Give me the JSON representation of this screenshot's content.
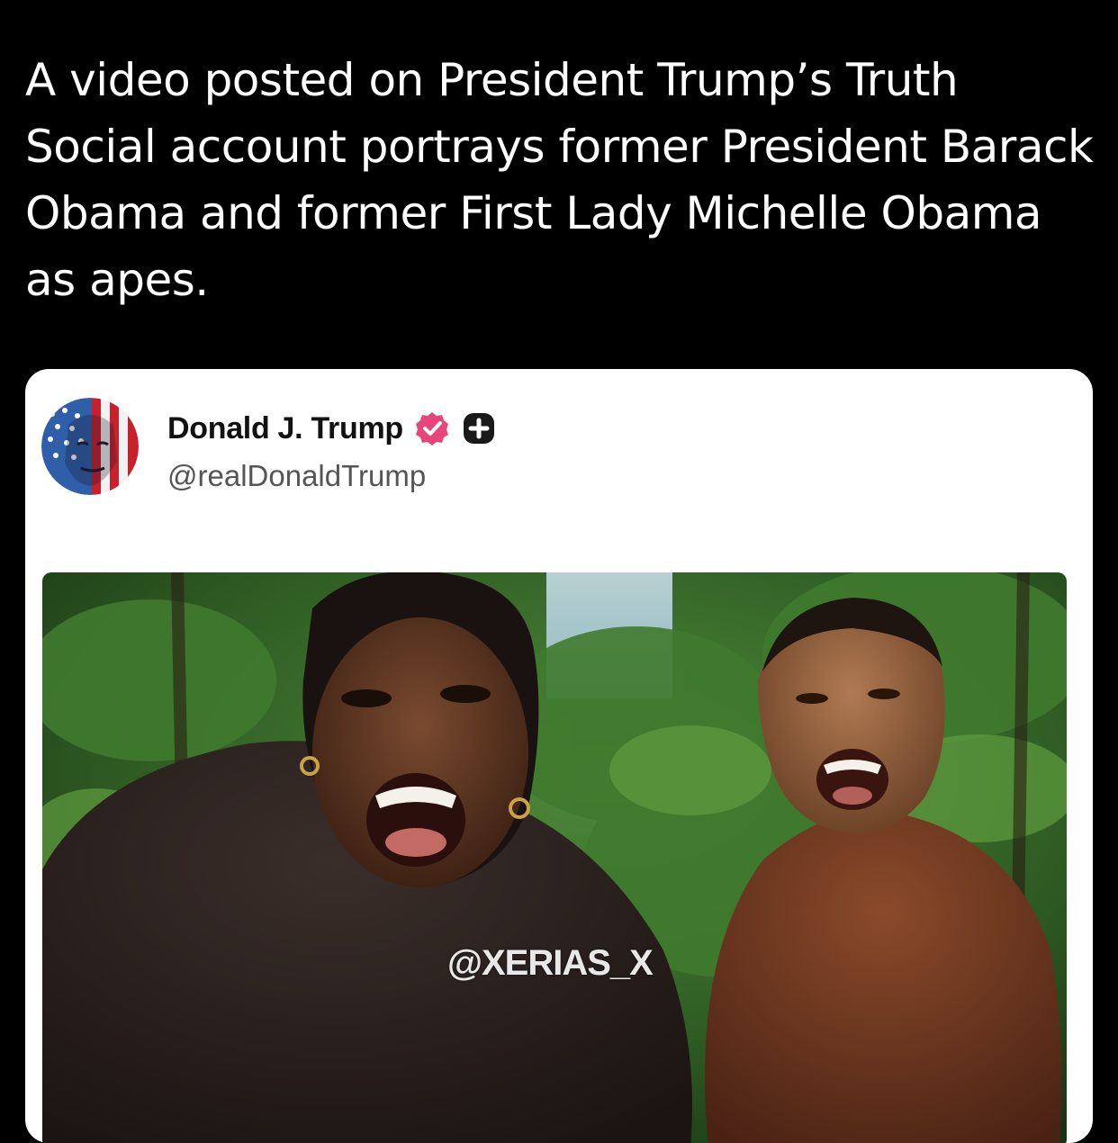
{
  "headline": "A video posted on President Trump’s Truth Social account portrays former President Barack Obama and former First Lady Michelle Obama as apes.",
  "post": {
    "display_name": "Donald J. Trump",
    "handle": "@realDonaldTrump",
    "icons": {
      "avatar": "flag-portrait-avatar",
      "verified": "verified-badge-icon",
      "plus": "plus-badge-icon"
    },
    "media": {
      "watermark": "@XERIAS_X"
    }
  },
  "colors": {
    "background": "#000000",
    "headline_text": "#ffffff",
    "card_background": "#ffffff",
    "verified_badge": "#e8457a",
    "handle_text": "#555555"
  }
}
